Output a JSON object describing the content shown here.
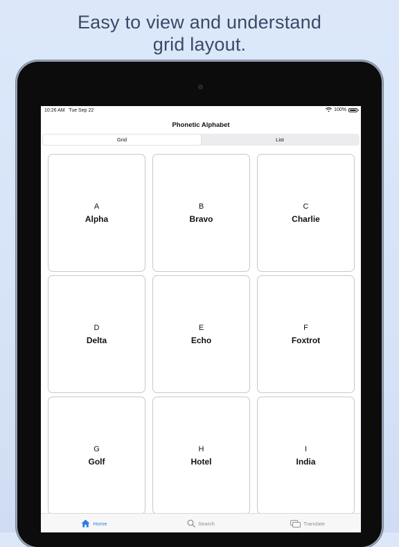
{
  "headline": {
    "line1": "Easy to view and understand",
    "line2": "grid layout."
  },
  "status_bar": {
    "time": "10:26 AM",
    "date": "Tue Sep 22",
    "battery": "100%"
  },
  "nav": {
    "title": "Phonetic Alphabet"
  },
  "segments": [
    {
      "label": "Grid",
      "selected": true
    },
    {
      "label": "List",
      "selected": false
    }
  ],
  "cards": [
    {
      "letter": "A",
      "word": "Alpha"
    },
    {
      "letter": "B",
      "word": "Bravo"
    },
    {
      "letter": "C",
      "word": "Charlie"
    },
    {
      "letter": "D",
      "word": "Delta"
    },
    {
      "letter": "E",
      "word": "Echo"
    },
    {
      "letter": "F",
      "word": "Foxtrot"
    },
    {
      "letter": "G",
      "word": "Golf"
    },
    {
      "letter": "H",
      "word": "Hotel"
    },
    {
      "letter": "I",
      "word": "India"
    }
  ],
  "tabs": [
    {
      "label": "Home",
      "icon": "home-icon",
      "active": true
    },
    {
      "label": "Search",
      "icon": "search-icon",
      "active": false
    },
    {
      "label": "Translate",
      "icon": "translate-icon",
      "active": false
    }
  ],
  "colors": {
    "accent": "#2f7de1",
    "inactive": "#8e8e93",
    "background": "#dce8fa",
    "headline": "#3a4a66"
  }
}
